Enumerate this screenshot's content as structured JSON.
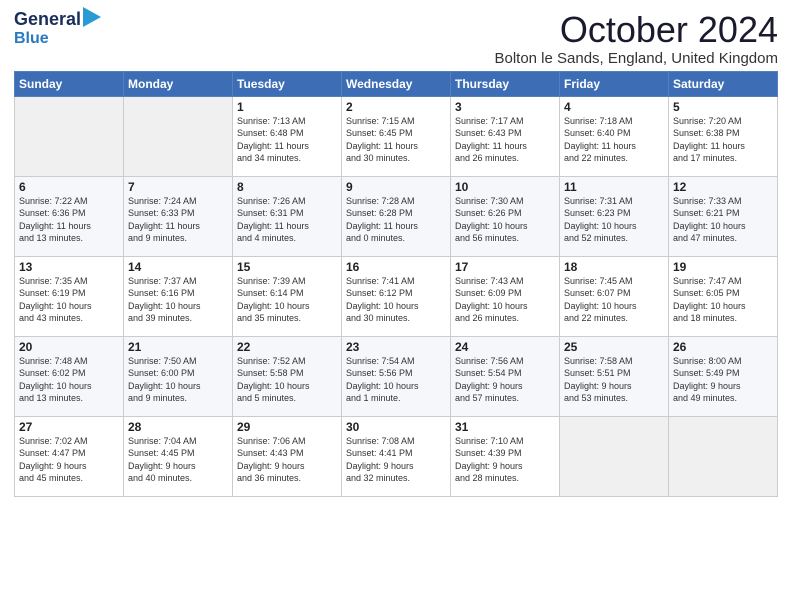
{
  "logo": {
    "line1": "General",
    "line2": "Blue"
  },
  "title": "October 2024",
  "subtitle": "Bolton le Sands, England, United Kingdom",
  "days_of_week": [
    "Sunday",
    "Monday",
    "Tuesday",
    "Wednesday",
    "Thursday",
    "Friday",
    "Saturday"
  ],
  "weeks": [
    [
      {
        "day": "",
        "info": ""
      },
      {
        "day": "",
        "info": ""
      },
      {
        "day": "1",
        "info": "Sunrise: 7:13 AM\nSunset: 6:48 PM\nDaylight: 11 hours\nand 34 minutes."
      },
      {
        "day": "2",
        "info": "Sunrise: 7:15 AM\nSunset: 6:45 PM\nDaylight: 11 hours\nand 30 minutes."
      },
      {
        "day": "3",
        "info": "Sunrise: 7:17 AM\nSunset: 6:43 PM\nDaylight: 11 hours\nand 26 minutes."
      },
      {
        "day": "4",
        "info": "Sunrise: 7:18 AM\nSunset: 6:40 PM\nDaylight: 11 hours\nand 22 minutes."
      },
      {
        "day": "5",
        "info": "Sunrise: 7:20 AM\nSunset: 6:38 PM\nDaylight: 11 hours\nand 17 minutes."
      }
    ],
    [
      {
        "day": "6",
        "info": "Sunrise: 7:22 AM\nSunset: 6:36 PM\nDaylight: 11 hours\nand 13 minutes."
      },
      {
        "day": "7",
        "info": "Sunrise: 7:24 AM\nSunset: 6:33 PM\nDaylight: 11 hours\nand 9 minutes."
      },
      {
        "day": "8",
        "info": "Sunrise: 7:26 AM\nSunset: 6:31 PM\nDaylight: 11 hours\nand 4 minutes."
      },
      {
        "day": "9",
        "info": "Sunrise: 7:28 AM\nSunset: 6:28 PM\nDaylight: 11 hours\nand 0 minutes."
      },
      {
        "day": "10",
        "info": "Sunrise: 7:30 AM\nSunset: 6:26 PM\nDaylight: 10 hours\nand 56 minutes."
      },
      {
        "day": "11",
        "info": "Sunrise: 7:31 AM\nSunset: 6:23 PM\nDaylight: 10 hours\nand 52 minutes."
      },
      {
        "day": "12",
        "info": "Sunrise: 7:33 AM\nSunset: 6:21 PM\nDaylight: 10 hours\nand 47 minutes."
      }
    ],
    [
      {
        "day": "13",
        "info": "Sunrise: 7:35 AM\nSunset: 6:19 PM\nDaylight: 10 hours\nand 43 minutes."
      },
      {
        "day": "14",
        "info": "Sunrise: 7:37 AM\nSunset: 6:16 PM\nDaylight: 10 hours\nand 39 minutes."
      },
      {
        "day": "15",
        "info": "Sunrise: 7:39 AM\nSunset: 6:14 PM\nDaylight: 10 hours\nand 35 minutes."
      },
      {
        "day": "16",
        "info": "Sunrise: 7:41 AM\nSunset: 6:12 PM\nDaylight: 10 hours\nand 30 minutes."
      },
      {
        "day": "17",
        "info": "Sunrise: 7:43 AM\nSunset: 6:09 PM\nDaylight: 10 hours\nand 26 minutes."
      },
      {
        "day": "18",
        "info": "Sunrise: 7:45 AM\nSunset: 6:07 PM\nDaylight: 10 hours\nand 22 minutes."
      },
      {
        "day": "19",
        "info": "Sunrise: 7:47 AM\nSunset: 6:05 PM\nDaylight: 10 hours\nand 18 minutes."
      }
    ],
    [
      {
        "day": "20",
        "info": "Sunrise: 7:48 AM\nSunset: 6:02 PM\nDaylight: 10 hours\nand 13 minutes."
      },
      {
        "day": "21",
        "info": "Sunrise: 7:50 AM\nSunset: 6:00 PM\nDaylight: 10 hours\nand 9 minutes."
      },
      {
        "day": "22",
        "info": "Sunrise: 7:52 AM\nSunset: 5:58 PM\nDaylight: 10 hours\nand 5 minutes."
      },
      {
        "day": "23",
        "info": "Sunrise: 7:54 AM\nSunset: 5:56 PM\nDaylight: 10 hours\nand 1 minute."
      },
      {
        "day": "24",
        "info": "Sunrise: 7:56 AM\nSunset: 5:54 PM\nDaylight: 9 hours\nand 57 minutes."
      },
      {
        "day": "25",
        "info": "Sunrise: 7:58 AM\nSunset: 5:51 PM\nDaylight: 9 hours\nand 53 minutes."
      },
      {
        "day": "26",
        "info": "Sunrise: 8:00 AM\nSunset: 5:49 PM\nDaylight: 9 hours\nand 49 minutes."
      }
    ],
    [
      {
        "day": "27",
        "info": "Sunrise: 7:02 AM\nSunset: 4:47 PM\nDaylight: 9 hours\nand 45 minutes."
      },
      {
        "day": "28",
        "info": "Sunrise: 7:04 AM\nSunset: 4:45 PM\nDaylight: 9 hours\nand 40 minutes."
      },
      {
        "day": "29",
        "info": "Sunrise: 7:06 AM\nSunset: 4:43 PM\nDaylight: 9 hours\nand 36 minutes."
      },
      {
        "day": "30",
        "info": "Sunrise: 7:08 AM\nSunset: 4:41 PM\nDaylight: 9 hours\nand 32 minutes."
      },
      {
        "day": "31",
        "info": "Sunrise: 7:10 AM\nSunset: 4:39 PM\nDaylight: 9 hours\nand 28 minutes."
      },
      {
        "day": "",
        "info": ""
      },
      {
        "day": "",
        "info": ""
      }
    ]
  ]
}
